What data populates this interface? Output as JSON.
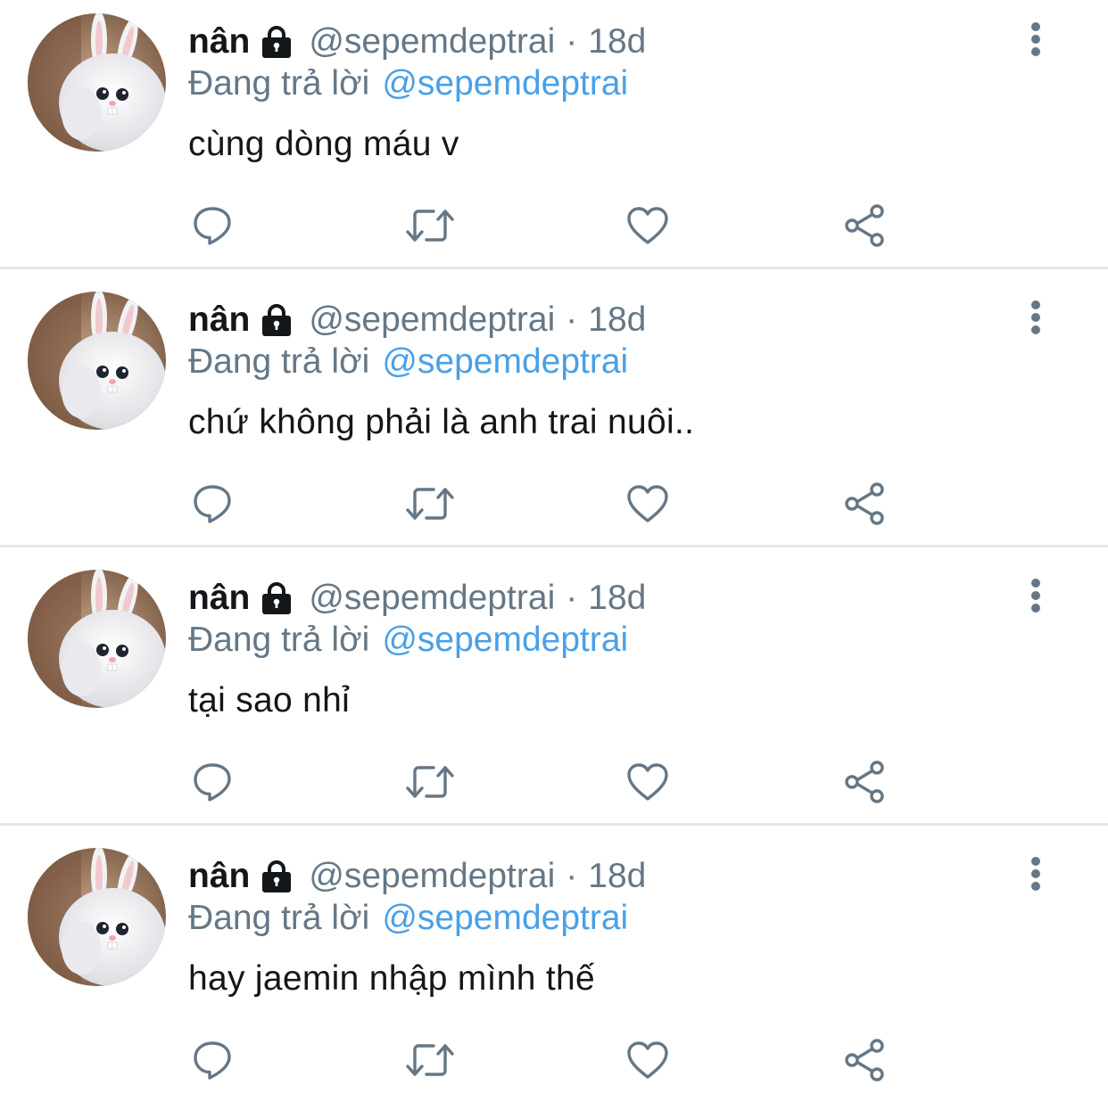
{
  "tweets": [
    {
      "name": "nân",
      "handle": "@sepemdeptrai",
      "separator": "·",
      "time": "18d",
      "reply_prefix": "Đang trả lời",
      "reply_to": "@sepemdeptrai",
      "text": "cùng dòng máu v"
    },
    {
      "name": "nân",
      "handle": "@sepemdeptrai",
      "separator": "·",
      "time": "18d",
      "reply_prefix": "Đang trả lời",
      "reply_to": "@sepemdeptrai",
      "text": "chứ không phải là anh trai nuôi.."
    },
    {
      "name": "nân",
      "handle": "@sepemdeptrai",
      "separator": "·",
      "time": "18d",
      "reply_prefix": "Đang trả lời",
      "reply_to": "@sepemdeptrai",
      "text": "tại sao nhỉ"
    },
    {
      "name": "nân",
      "handle": "@sepemdeptrai",
      "separator": "·",
      "time": "18d",
      "reply_prefix": "Đang trả lời",
      "reply_to": "@sepemdeptrai",
      "text": "hay jaemin nhập mình thế"
    }
  ],
  "icons": {
    "lock": "lock-icon",
    "more": "more-vertical-icon",
    "reply": "reply-bubble-icon",
    "retweet": "retweet-icon",
    "like": "heart-icon",
    "share": "share-icon"
  },
  "colors": {
    "text": "#14171a",
    "secondary": "#657786",
    "mention": "#4aa0e6",
    "divider": "#e4e8ec"
  }
}
